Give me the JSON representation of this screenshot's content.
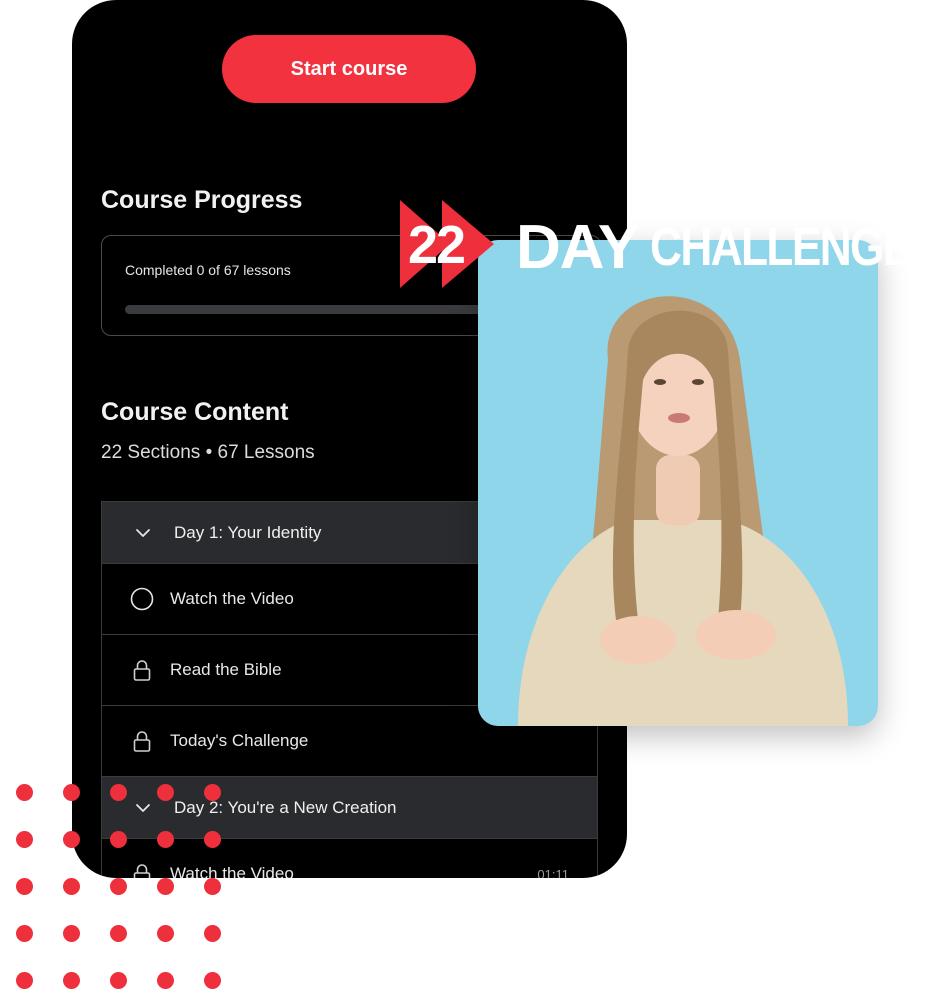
{
  "header": {
    "start_button": "Start course"
  },
  "progress": {
    "title": "Course Progress",
    "label": "Completed 0 of 67 lessons",
    "completed": 0,
    "total": 67
  },
  "content": {
    "title": "Course Content",
    "summary": "22 Sections • 67 Lessons",
    "sections": [
      {
        "title": "Day 1: Your Identity",
        "lessons": [
          {
            "title": "Watch the Video",
            "icon": "circle-icon",
            "duration": ""
          },
          {
            "title": "Read the Bible",
            "icon": "lock-icon",
            "duration": ""
          },
          {
            "title": "Today's Challenge",
            "icon": "lock-icon",
            "duration": ""
          }
        ]
      },
      {
        "title": "Day 2: You're a New Creation",
        "lessons": [
          {
            "title": "Watch the Video",
            "icon": "lock-icon",
            "duration": "01:11"
          }
        ]
      }
    ]
  },
  "promo": {
    "logo_number": "22",
    "logo_day": "DAY",
    "logo_challenge": "CHALLENGE"
  },
  "colors": {
    "accent": "#f2323f",
    "card_bg": "#000000",
    "section_bg": "#2a2b2e",
    "video_bg": "#8fd6ea"
  }
}
